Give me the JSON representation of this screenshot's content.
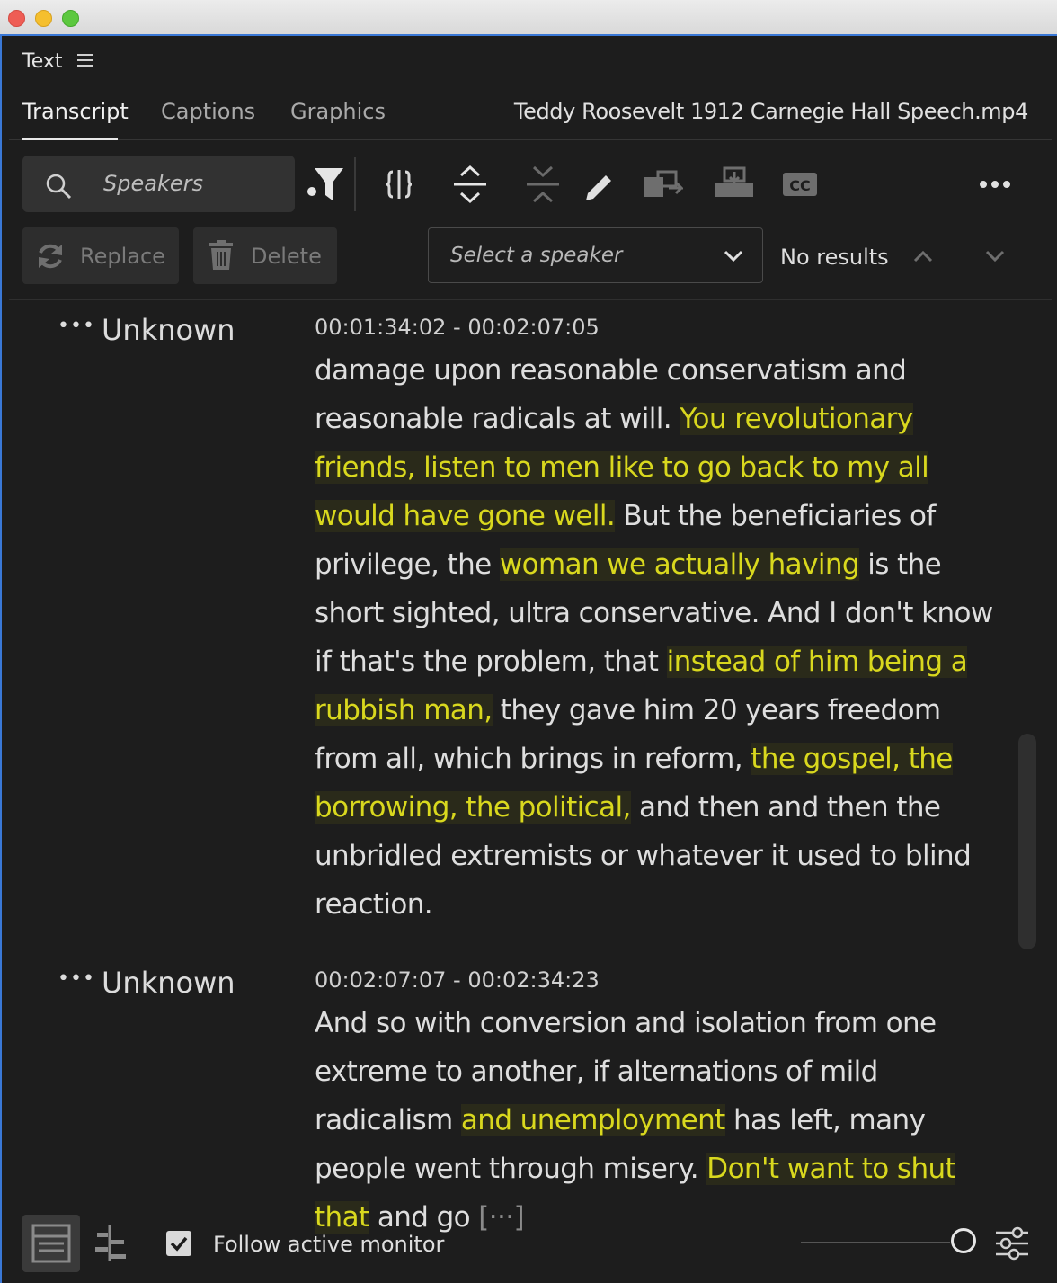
{
  "panel": {
    "title": "Text"
  },
  "tabs": [
    {
      "label": "Transcript",
      "active": true
    },
    {
      "label": "Captions",
      "active": false
    },
    {
      "label": "Graphics",
      "active": false
    }
  ],
  "file_name": "Teddy Roosevelt 1912 Carnegie Hall Speech.mp4",
  "toolbar": {
    "search_placeholder": "Speakers",
    "replace_label": "Replace",
    "delete_label": "Delete",
    "speaker_select_placeholder": "Select a speaker",
    "results_text": "No results"
  },
  "segments": [
    {
      "speaker": "Unknown",
      "timecode": "00:01:34:02 - 00:02:07:05",
      "parts": [
        {
          "text": "damage upon reasonable conservatism and reasonable radicals at will. ",
          "highlight": false
        },
        {
          "text": "You revolutionary friends, listen to men like to go back to my all would have gone well.",
          "highlight": true
        },
        {
          "text": " But the beneficiaries of privilege, the ",
          "highlight": false
        },
        {
          "text": "woman we actually having",
          "highlight": true
        },
        {
          "text": " is the short sighted, ultra conservative. And I don't know if that's the problem, that ",
          "highlight": false
        },
        {
          "text": "instead of him being a rubbish man,",
          "highlight": true
        },
        {
          "text": " they gave him 20 years freedom from all, which brings in reform, ",
          "highlight": false
        },
        {
          "text": "the gospel, the borrowing, the political,",
          "highlight": true
        },
        {
          "text": " and then and then the unbridled extremists or whatever it used to blind reaction.",
          "highlight": false
        }
      ]
    },
    {
      "speaker": "Unknown",
      "timecode": "00:02:07:07 - 00:02:34:23",
      "parts": [
        {
          "text": "And so with conversion and isolation from one extreme to another, if alternations of mild radicalism ",
          "highlight": false
        },
        {
          "text": "and unemployment",
          "highlight": true
        },
        {
          "text": " has left, many people went through misery. ",
          "highlight": false
        },
        {
          "text": "Don't want to shut that",
          "highlight": true
        },
        {
          "text": " and go ",
          "highlight": false
        },
        {
          "text": "[···]",
          "highlight": false,
          "muted": true
        }
      ]
    }
  ],
  "footer": {
    "follow_label": "Follow active monitor",
    "follow_checked": true
  },
  "colors": {
    "highlight_text": "#d9d81e",
    "accent_frame": "#3a78d6"
  }
}
